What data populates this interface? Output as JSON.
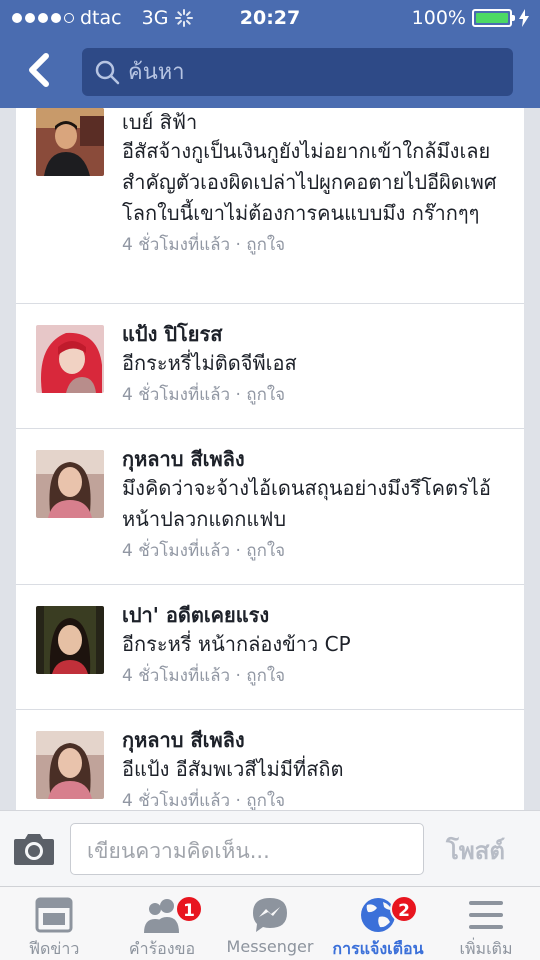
{
  "status_bar": {
    "carrier": "dtac",
    "network": "3G",
    "time": "20:27",
    "battery_percent": "100%",
    "signal_bars": 4
  },
  "search": {
    "placeholder": "ค้นหา"
  },
  "notifications": [
    {
      "name": "เบย์ สิฟ้า",
      "text": "อีสัสจ้างกูเป็นเงินกูยังไม่อยากเข้าใกล้มึงเลย สำคัญตัวเองผิดเปล่าไปผูกคอตายไปอีผิดเพศ โลกใบนี้เขาไม่ต้องการคนแบบมึง กร๊ากๆๆ",
      "time": "4 ชั่วโมงที่แล้ว",
      "separator": "·",
      "like": "ถูกใจ",
      "avatar_icon": "profile-photo-man"
    },
    {
      "name": "แป้ง ปิโยรส",
      "text": "อีกระหรี่ไม่ติดจีพีเอส",
      "time": "4 ชั่วโมงที่แล้ว",
      "separator": "·",
      "like": "ถูกใจ",
      "avatar_icon": "profile-photo-red-hair"
    },
    {
      "name": "กุหลาบ สีเพลิง",
      "text": "มึงคิดว่าจะจ้างไอ้เดนสถุนอย่างมึงรึโคตรไอ้หน้าปลวกแดกแฟบ",
      "time": "4 ชั่วโมงที่แล้ว",
      "separator": "·",
      "like": "ถูกใจ",
      "avatar_icon": "profile-photo-woman"
    },
    {
      "name": "เปา' อดีตเคยแรง",
      "text": "อีกระหรี่ หน้ากล่องข้าว CP",
      "time": "4 ชั่วโมงที่แล้ว",
      "separator": "·",
      "like": "ถูกใจ",
      "avatar_icon": "profile-photo-girl"
    },
    {
      "name": "กุหลาบ สีเพลิง",
      "text": "อีแป้ง อีสัมพเวสีไม่มีที่สถิต",
      "time": "4 ชั่วโมงที่แล้ว",
      "separator": "·",
      "like": "ถูกใจ",
      "avatar_icon": "profile-photo-woman"
    }
  ],
  "composer": {
    "placeholder": "เขียนความคิดเห็น...",
    "post_label": "โพสต์"
  },
  "tabs": [
    {
      "label": "ฟีดข่าว",
      "icon": "news-feed-icon",
      "badge": "",
      "active": false
    },
    {
      "label": "คำร้องขอ",
      "icon": "friend-requests-icon",
      "badge": "1",
      "active": false
    },
    {
      "label": "Messenger",
      "icon": "messenger-icon",
      "badge": "",
      "active": false
    },
    {
      "label": "การแจ้งเตือน",
      "icon": "globe-icon",
      "badge": "2",
      "active": true
    },
    {
      "label": "เพิ่มเติม",
      "icon": "menu-icon",
      "badge": "",
      "active": false
    }
  ],
  "colors": {
    "brand_blue": "#4a6cb0",
    "active_tab": "#3b70d9",
    "badge_red": "#e8151f",
    "battery_green": "#4cd964"
  }
}
